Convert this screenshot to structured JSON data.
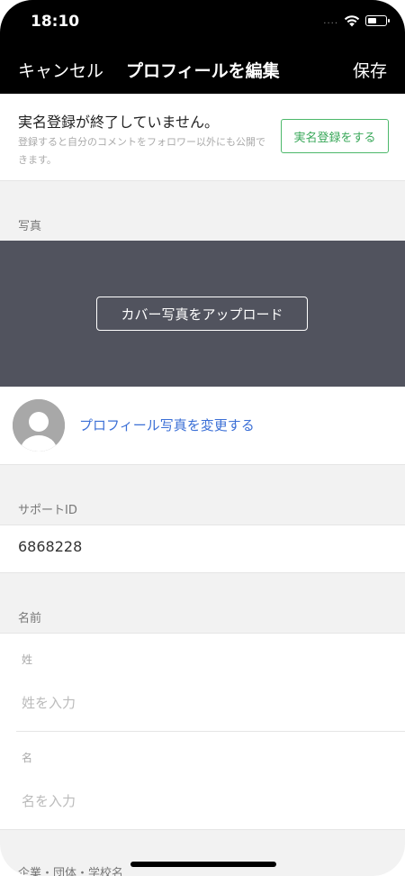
{
  "status_bar": {
    "time": "18:10",
    "signal_dots": "....",
    "wifi_icon": "wifi-icon",
    "battery_icon": "battery-icon"
  },
  "nav": {
    "cancel_label": "キャンセル",
    "title": "プロフィールを編集",
    "save_label": "保存"
  },
  "notice": {
    "title": "実名登録が終了していません。",
    "description": "登録すると自分のコメントをフォロワー以外にも公開できます。",
    "button_label": "実名登録をする"
  },
  "photo_section": {
    "label": "写真",
    "cover_button_label": "カバー写真をアップロード",
    "profile_photo_link": "プロフィール写真を変更する",
    "avatar_icon": "default-avatar-icon"
  },
  "support_section": {
    "label": "サポートID",
    "value": "6868228"
  },
  "name_section": {
    "label": "名前",
    "fields": [
      {
        "label": "姓",
        "placeholder": "姓を入力"
      },
      {
        "label": "名",
        "placeholder": "名を入力"
      }
    ]
  },
  "company_section": {
    "label": "企業・団体・学校名"
  },
  "colors": {
    "header": "#000000",
    "accent_green": "#3aa85a",
    "link_blue": "#3b6fd6",
    "cover_bg": "#51535e"
  }
}
